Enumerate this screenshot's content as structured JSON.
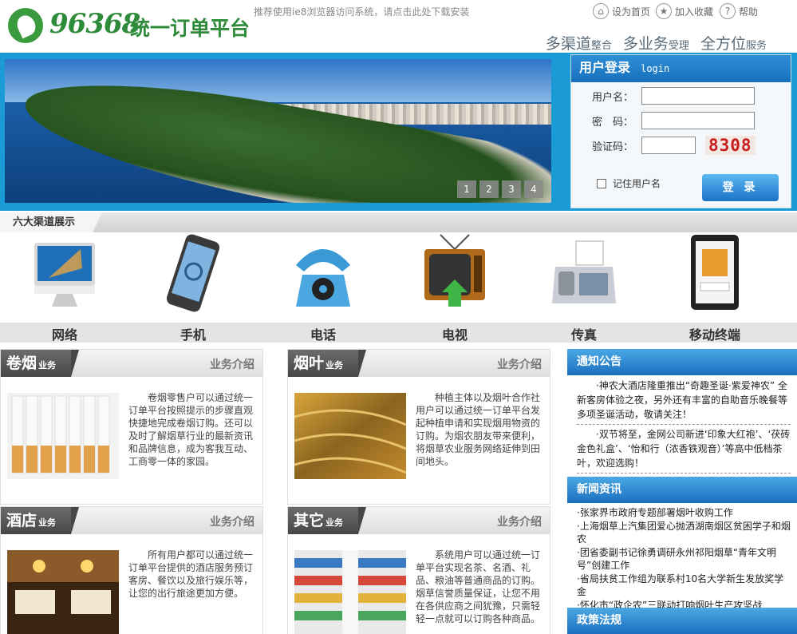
{
  "header": {
    "logo_number": "96368",
    "logo_text": "统一订单平台",
    "ie_tip": "推荐使用ie8浏览器访问系统，请点击此处下载安装",
    "links": [
      {
        "label": "设为首页",
        "icon": "home-icon"
      },
      {
        "label": "加入收藏",
        "icon": "bookmark-icon"
      },
      {
        "label": "帮助",
        "icon": "help-icon"
      }
    ],
    "slogan": [
      {
        "big": "多渠道",
        "small": "整合"
      },
      {
        "big": "多业务",
        "small": "受理"
      },
      {
        "big": "全方位",
        "small": "服务"
      }
    ]
  },
  "banner": {
    "pages": [
      "1",
      "2",
      "3",
      "4"
    ]
  },
  "login": {
    "title": "用户登录",
    "subtitle": "login",
    "username_label": "用户名：",
    "password_label": "密　码：",
    "captcha_label": "验证码：",
    "captcha_code": "8308",
    "remember_label": "记住用户名",
    "submit_label": "登 录"
  },
  "channels": {
    "title": "六大渠道展示",
    "items": [
      {
        "label": "网络",
        "icon": "computer-icon"
      },
      {
        "label": "手机",
        "icon": "mobile-phone-icon"
      },
      {
        "label": "电话",
        "icon": "telephone-icon"
      },
      {
        "label": "电视",
        "icon": "television-icon"
      },
      {
        "label": "传真",
        "icon": "fax-icon"
      },
      {
        "label": "移动终端",
        "icon": "tablet-icon"
      }
    ]
  },
  "business": [
    {
      "name": "卷烟",
      "suffix": "业务",
      "link": "业务介绍",
      "text": "卷烟零售户可以通过统一订单平台按照提示的步骤直观快捷地完成卷烟订购。还可以及时了解烟草行业的最新资讯和品牌信息，成为客我互动、工商零一体的家园。"
    },
    {
      "name": "烟叶",
      "suffix": "业务",
      "link": "业务介绍",
      "text": "种植主体以及烟叶合作社用户可以通过统一订单平台发起种植申请和实现烟用物资的订购。为烟农朋友带来便利，将烟草农业服务网络延伸到田间地头。"
    },
    {
      "name": "酒店",
      "suffix": "业务",
      "link": "业务介绍",
      "text": "所有用户都可以通过统一订单平台提供的酒店服务预订客房、餐饮以及旅行娱乐等，让您的出行旅途更加方便。"
    },
    {
      "name": "其它",
      "suffix": "业务",
      "link": "业务介绍",
      "text": "系统用户可以通过统一订单平台实现名茶、名酒、礼品、粮油等普通商品的订购。烟草信誉质量保证，让您不用在各供应商之间犹豫，只需轻轻一点就可以订购各种商品。"
    }
  ],
  "notice": {
    "title": "通知公告",
    "items": [
      "·神农大酒店隆重推出“奇趣圣诞·紫爱神农” 全新客房体验之夜，另外还有丰富的自助音乐晚餐等多项圣诞活动，敬请关注！",
      "·双节将至，金网公司新进‘印象大红袍’、‘茯砖金色礼盒’、‘怡和行（浓香铁观音）’等高中低档茶叶，欢迎选购！"
    ]
  },
  "news": {
    "title": "新闻资讯",
    "items": [
      "·张家界市政府专题部署烟叶收购工作",
      "·上海烟草上汽集团爱心抛洒湖南烟区贫困学子和烟农",
      "·团省委副书记徐勇调研永州祁阳烟草“青年文明号”创建工作",
      "·省局扶贫工作组为联系村10名大学新生发放奖学金",
      "·怀化市“政企农”三联动打响烟叶生产攻坚战"
    ]
  },
  "policy": {
    "title": "政策法规"
  }
}
